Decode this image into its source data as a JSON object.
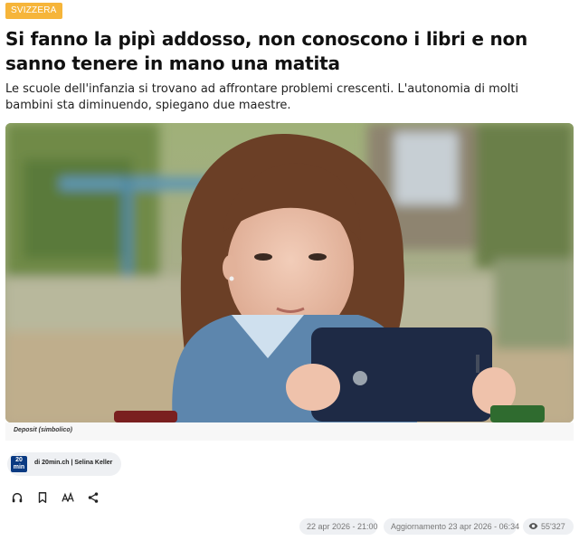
{
  "article": {
    "category": "SVIZZERA",
    "title": "Si fanno la pipì addosso, non conoscono i libri e non sanno tenere in mano una matita",
    "lead": "Le scuole dell'infanzia si trovano ad affrontare problemi crescenti. L'autonomia di molti bambini sta diminuendo, spiegano due maestre.",
    "image_caption": "Deposit (simbolico)",
    "author": {
      "logo_top": "20",
      "logo_bottom": "min",
      "text": "di 20min.ch | Selina Keller"
    },
    "meta": {
      "published": "22 apr 2026 - 21:00",
      "updated": "Aggiornamento 23 apr 2026 - 06:34",
      "views": "55'327"
    }
  },
  "toolbar": {
    "icons": [
      "headphones-icon",
      "bookmark-icon",
      "font-size-icon",
      "share-icon"
    ]
  },
  "colors": {
    "tag_bg": "#f6b53a",
    "chip_bg": "#eef0f3",
    "logo_bg": "#0a3a82"
  }
}
